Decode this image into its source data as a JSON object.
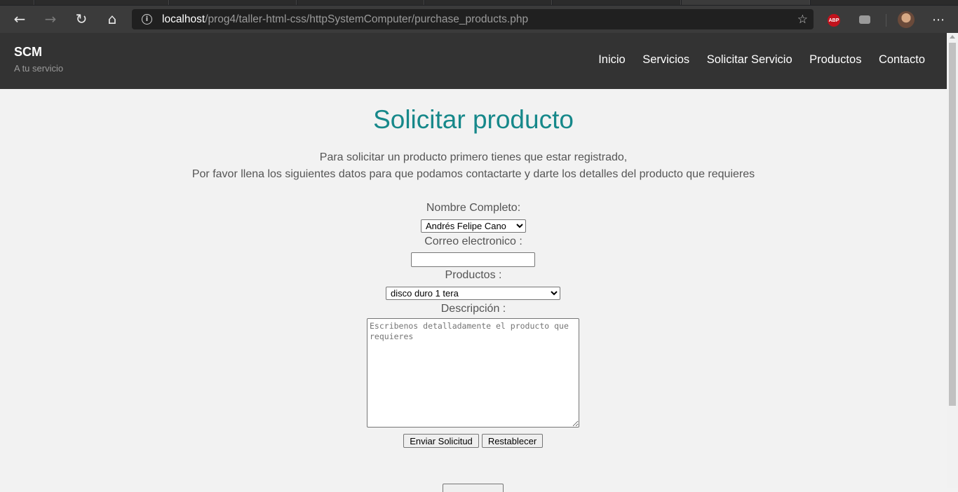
{
  "browser": {
    "url_host": "localhost",
    "url_path": "/prog4/taller-html-css/httpSystemComputer/purchase_products.php",
    "icons": {
      "back": "back-arrow-icon",
      "forward": "forward-arrow-icon",
      "refresh": "refresh-icon",
      "home": "home-icon",
      "info": "info-icon",
      "favorite": "add-favorite-icon",
      "abp": "adblock-icon",
      "ext": "extension-icon",
      "profile": "profile-avatar",
      "more": "more-options-icon"
    },
    "abp_label": "ABP"
  },
  "site": {
    "brand": "SCM",
    "tagline": "A tu servicio",
    "nav": [
      "Inicio",
      "Servicios",
      "Solicitar Servicio",
      "Productos",
      "Contacto"
    ]
  },
  "main": {
    "title": "Solicitar producto",
    "intro_line1": "Para solicitar un producto primero tienes que estar registrado,",
    "intro_line2": "Por favor llena los siguientes datos para que podamos contactarte y darte los detalles del producto que requieres",
    "form": {
      "name_label": "Nombre Completo:",
      "name_value": "Andrés Felipe Cano",
      "email_label": "Correo electronico :",
      "email_value": "",
      "product_label": "Productos :",
      "product_value": "disco duro 1 tera",
      "description_label": "Descripción :",
      "description_placeholder": "Escribenos detalladamente el producto que requieres",
      "submit_label": "Enviar Solicitud",
      "reset_label": "Restablecer"
    }
  },
  "colors": {
    "title": "#16888a",
    "header_bg": "#333333",
    "page_bg": "#f2f2f2",
    "text": "#555555"
  }
}
